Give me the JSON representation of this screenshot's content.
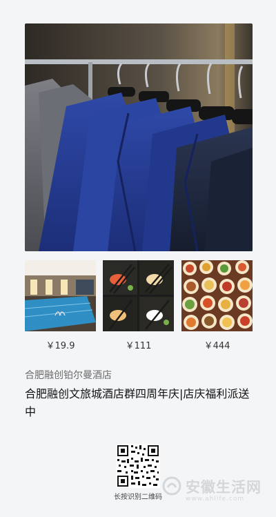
{
  "poster": {
    "hero_image": "suits-on-rack-photo",
    "thumbnails": [
      {
        "image": "indoor-pool-photo",
        "price": "￥19.9"
      },
      {
        "image": "sushi-chopsticks-photo",
        "price": "￥111"
      },
      {
        "image": "buffet-dishes-photo",
        "price": "￥444"
      }
    ],
    "hotel_name": "合肥融创铂尔曼酒店",
    "title": "合肥融创文旅城酒店群四周年庆|店庆福利派送中",
    "qr_label": "长按识别二维码"
  },
  "watermark": {
    "text": "安徽生活网",
    "url": "www.ahlife.com"
  },
  "colors": {
    "background": "#f4f5f7",
    "title_text": "#111111",
    "secondary_text": "#6b6b6b"
  }
}
